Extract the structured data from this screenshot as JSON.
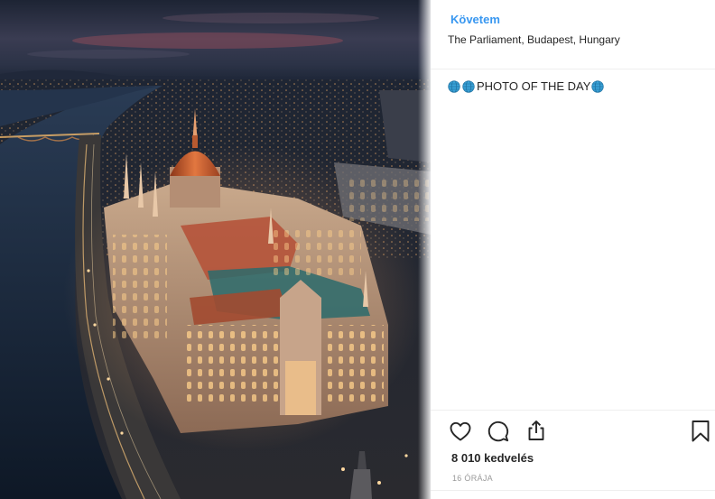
{
  "header": {
    "follow_label": "Követem",
    "location": "The Parliament, Budapest, Hungary"
  },
  "caption": {
    "text": "PHOTO OF THE DAY",
    "emoji_icon": "globe-icon"
  },
  "actions": {
    "like_icon": "heart-icon",
    "comment_icon": "comment-bubble-icon",
    "share_icon": "share-icon",
    "save_icon": "bookmark-icon",
    "likes_text": "8 010 kedvelés",
    "time_text": "16 ÓRÁJA"
  },
  "colors": {
    "link": "#3897f0",
    "text": "#262626",
    "muted": "#999999",
    "divider": "#efefef",
    "photo_sky": "#2b3447",
    "photo_glow": "#e07a3c"
  }
}
